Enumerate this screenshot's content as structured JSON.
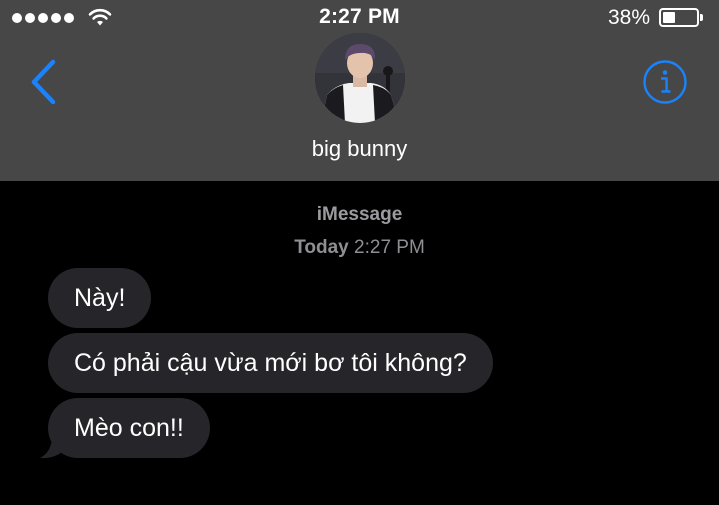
{
  "status_bar": {
    "signal_bars": 5,
    "time": "2:27 PM",
    "battery_percent": "38%",
    "battery_level": 0.38
  },
  "header": {
    "contact_name": "big bunny",
    "back_icon": "chevron-left-icon",
    "info_icon": "info-icon",
    "accent_color": "#1a82fb",
    "background_color": "#474747"
  },
  "conversation": {
    "service": "iMessage",
    "timestamp_day": "Today",
    "timestamp_time": "2:27 PM",
    "messages": [
      {
        "sender": "contact",
        "text": "Này!"
      },
      {
        "sender": "contact",
        "text": "Có phải cậu vừa mới bơ tôi không?"
      },
      {
        "sender": "contact",
        "text": "Mèo con!!"
      }
    ],
    "bubble_color": "#26252a"
  }
}
